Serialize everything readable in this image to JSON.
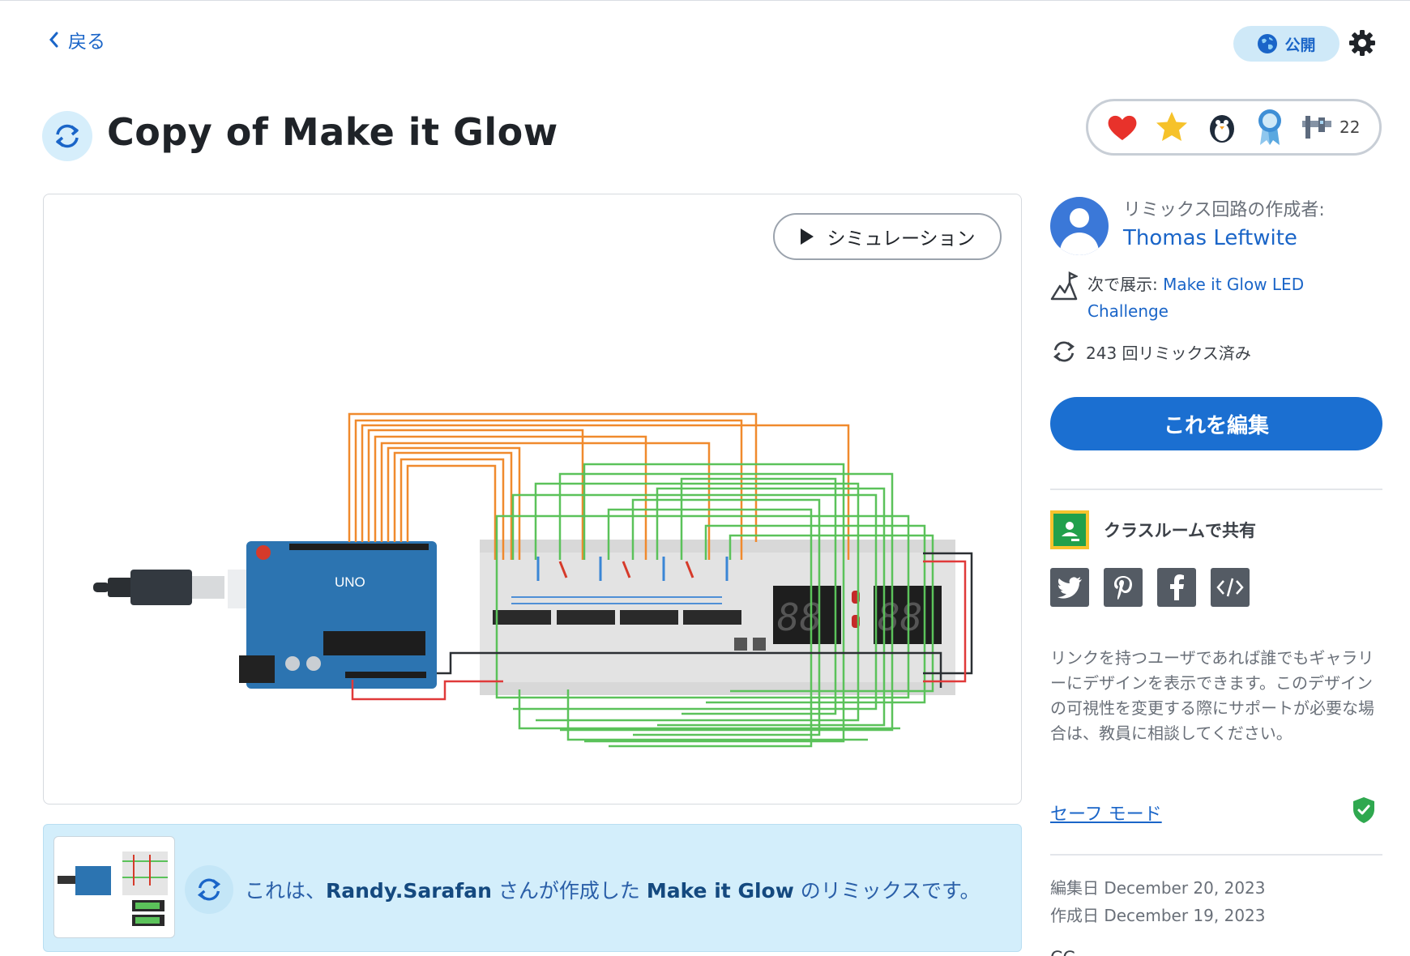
{
  "header": {
    "back_label": "戻る",
    "public_label": "公開"
  },
  "project": {
    "title": "Copy of Make it Glow",
    "badge_count": "22",
    "simulation_label": "シミュレーション"
  },
  "remix_note": {
    "prefix": "これは、",
    "author": "Randy.Sarafan",
    "middle": " さんが作成した ",
    "original": "Make it Glow",
    "suffix": " のリミックスです。"
  },
  "sidebar": {
    "author_label": "リミックス回路の作成者:",
    "author_name": "Thomas Leftwite",
    "featured_label": "次で展示:",
    "featured_link": " Make it Glow LED Challenge",
    "remix_count_text": "243 回リミックス済み",
    "edit_label": "これを編集",
    "classroom_label": "クラスルームで共有",
    "info_text": "リンクを持つユーザであれば誰でもギャラリーにデザインを表示できます。このデザインの可視性を変更する際にサポートが必要な場合は、教員に相談してください。",
    "safe_mode_label": "セーフ モード",
    "edited_label": "編集日 December 20, 2023",
    "created_label": "作成日 December 19, 2023",
    "cc_label": "CC"
  },
  "icons": [
    "chevron-left-icon",
    "globe-icon",
    "gear-icon",
    "remix-icon",
    "heart-icon",
    "star-icon",
    "penguin-icon",
    "ribbon-icon",
    "caliper-icon",
    "play-icon",
    "featured-icon",
    "google-classroom-icon",
    "twitter-icon",
    "pinterest-icon",
    "facebook-icon",
    "embed-icon",
    "shield-check-icon"
  ],
  "colors": {
    "accent": "#1b6fd1",
    "link": "#1a65c8",
    "note_bg": "#d3eefb",
    "public_bg": "#cfe9f8",
    "safe_shield": "#2fa84f"
  }
}
